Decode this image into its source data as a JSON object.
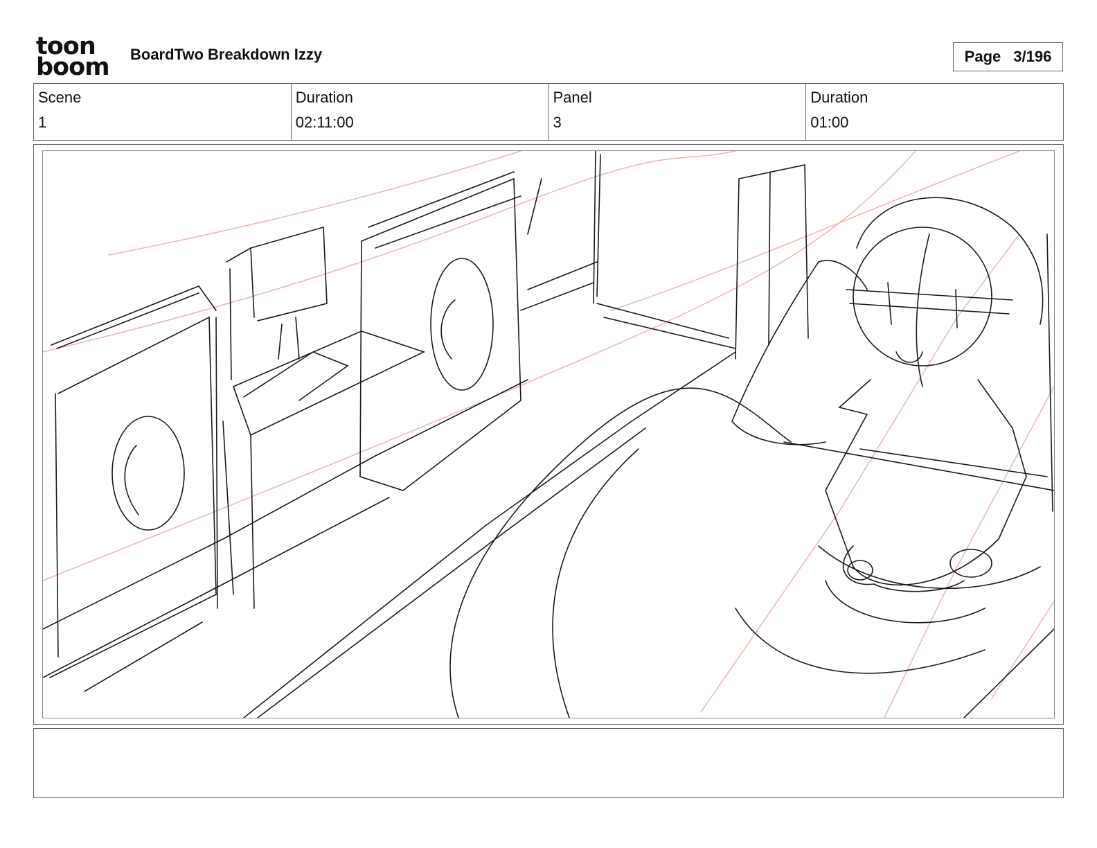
{
  "header": {
    "logo_line1": "toon",
    "logo_line2": "boom",
    "title": "BoardTwo Breakdown Izzy",
    "page_label": "Page",
    "page_value": "3/196"
  },
  "info": {
    "scene_label": "Scene",
    "scene_value": "1",
    "scene_duration_label": "Duration",
    "scene_duration_value": "02:11:00",
    "panel_label": "Panel",
    "panel_value": "3",
    "panel_duration_label": "Duration",
    "panel_duration_value": "01:00"
  },
  "colors": {
    "sketch_line": "#1a1a1a",
    "guide_line": "#e9b7ad",
    "border": "#666666"
  },
  "notes": {
    "text": ""
  }
}
